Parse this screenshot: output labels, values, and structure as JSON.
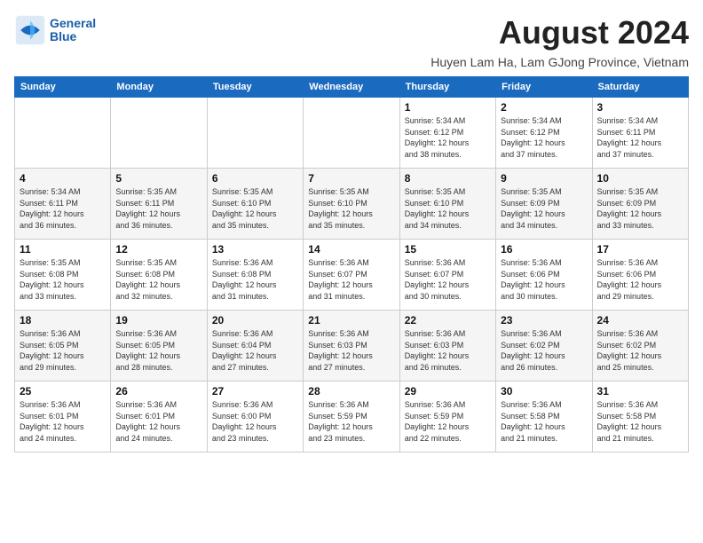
{
  "header": {
    "title": "August 2024",
    "subtitle": "Huyen Lam Ha, Lam GJong Province, Vietnam",
    "logo_line1": "General",
    "logo_line2": "Blue"
  },
  "weekdays": [
    "Sunday",
    "Monday",
    "Tuesday",
    "Wednesday",
    "Thursday",
    "Friday",
    "Saturday"
  ],
  "weeks": [
    [
      {
        "day": "",
        "info": ""
      },
      {
        "day": "",
        "info": ""
      },
      {
        "day": "",
        "info": ""
      },
      {
        "day": "",
        "info": ""
      },
      {
        "day": "1",
        "info": "Sunrise: 5:34 AM\nSunset: 6:12 PM\nDaylight: 12 hours\nand 38 minutes."
      },
      {
        "day": "2",
        "info": "Sunrise: 5:34 AM\nSunset: 6:12 PM\nDaylight: 12 hours\nand 37 minutes."
      },
      {
        "day": "3",
        "info": "Sunrise: 5:34 AM\nSunset: 6:11 PM\nDaylight: 12 hours\nand 37 minutes."
      }
    ],
    [
      {
        "day": "4",
        "info": "Sunrise: 5:34 AM\nSunset: 6:11 PM\nDaylight: 12 hours\nand 36 minutes."
      },
      {
        "day": "5",
        "info": "Sunrise: 5:35 AM\nSunset: 6:11 PM\nDaylight: 12 hours\nand 36 minutes."
      },
      {
        "day": "6",
        "info": "Sunrise: 5:35 AM\nSunset: 6:10 PM\nDaylight: 12 hours\nand 35 minutes."
      },
      {
        "day": "7",
        "info": "Sunrise: 5:35 AM\nSunset: 6:10 PM\nDaylight: 12 hours\nand 35 minutes."
      },
      {
        "day": "8",
        "info": "Sunrise: 5:35 AM\nSunset: 6:10 PM\nDaylight: 12 hours\nand 34 minutes."
      },
      {
        "day": "9",
        "info": "Sunrise: 5:35 AM\nSunset: 6:09 PM\nDaylight: 12 hours\nand 34 minutes."
      },
      {
        "day": "10",
        "info": "Sunrise: 5:35 AM\nSunset: 6:09 PM\nDaylight: 12 hours\nand 33 minutes."
      }
    ],
    [
      {
        "day": "11",
        "info": "Sunrise: 5:35 AM\nSunset: 6:08 PM\nDaylight: 12 hours\nand 33 minutes."
      },
      {
        "day": "12",
        "info": "Sunrise: 5:35 AM\nSunset: 6:08 PM\nDaylight: 12 hours\nand 32 minutes."
      },
      {
        "day": "13",
        "info": "Sunrise: 5:36 AM\nSunset: 6:08 PM\nDaylight: 12 hours\nand 31 minutes."
      },
      {
        "day": "14",
        "info": "Sunrise: 5:36 AM\nSunset: 6:07 PM\nDaylight: 12 hours\nand 31 minutes."
      },
      {
        "day": "15",
        "info": "Sunrise: 5:36 AM\nSunset: 6:07 PM\nDaylight: 12 hours\nand 30 minutes."
      },
      {
        "day": "16",
        "info": "Sunrise: 5:36 AM\nSunset: 6:06 PM\nDaylight: 12 hours\nand 30 minutes."
      },
      {
        "day": "17",
        "info": "Sunrise: 5:36 AM\nSunset: 6:06 PM\nDaylight: 12 hours\nand 29 minutes."
      }
    ],
    [
      {
        "day": "18",
        "info": "Sunrise: 5:36 AM\nSunset: 6:05 PM\nDaylight: 12 hours\nand 29 minutes."
      },
      {
        "day": "19",
        "info": "Sunrise: 5:36 AM\nSunset: 6:05 PM\nDaylight: 12 hours\nand 28 minutes."
      },
      {
        "day": "20",
        "info": "Sunrise: 5:36 AM\nSunset: 6:04 PM\nDaylight: 12 hours\nand 27 minutes."
      },
      {
        "day": "21",
        "info": "Sunrise: 5:36 AM\nSunset: 6:03 PM\nDaylight: 12 hours\nand 27 minutes."
      },
      {
        "day": "22",
        "info": "Sunrise: 5:36 AM\nSunset: 6:03 PM\nDaylight: 12 hours\nand 26 minutes."
      },
      {
        "day": "23",
        "info": "Sunrise: 5:36 AM\nSunset: 6:02 PM\nDaylight: 12 hours\nand 26 minutes."
      },
      {
        "day": "24",
        "info": "Sunrise: 5:36 AM\nSunset: 6:02 PM\nDaylight: 12 hours\nand 25 minutes."
      }
    ],
    [
      {
        "day": "25",
        "info": "Sunrise: 5:36 AM\nSunset: 6:01 PM\nDaylight: 12 hours\nand 24 minutes."
      },
      {
        "day": "26",
        "info": "Sunrise: 5:36 AM\nSunset: 6:01 PM\nDaylight: 12 hours\nand 24 minutes."
      },
      {
        "day": "27",
        "info": "Sunrise: 5:36 AM\nSunset: 6:00 PM\nDaylight: 12 hours\nand 23 minutes."
      },
      {
        "day": "28",
        "info": "Sunrise: 5:36 AM\nSunset: 5:59 PM\nDaylight: 12 hours\nand 23 minutes."
      },
      {
        "day": "29",
        "info": "Sunrise: 5:36 AM\nSunset: 5:59 PM\nDaylight: 12 hours\nand 22 minutes."
      },
      {
        "day": "30",
        "info": "Sunrise: 5:36 AM\nSunset: 5:58 PM\nDaylight: 12 hours\nand 21 minutes."
      },
      {
        "day": "31",
        "info": "Sunrise: 5:36 AM\nSunset: 5:58 PM\nDaylight: 12 hours\nand 21 minutes."
      }
    ]
  ]
}
